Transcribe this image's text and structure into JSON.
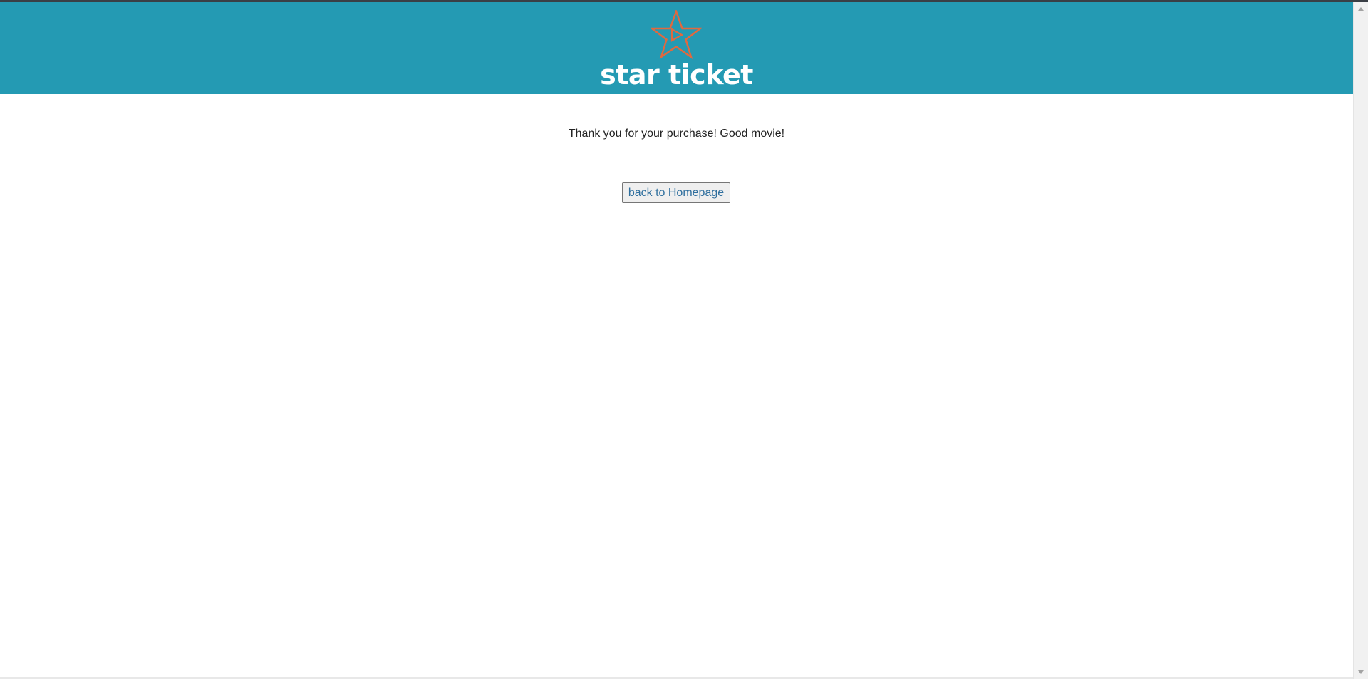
{
  "header": {
    "brand_name": "star ticket",
    "logo_icon": "star-play-icon",
    "background_color": "#249ab3",
    "logo_color": "#e0693f"
  },
  "main": {
    "message": "Thank you for your purchase! Good movie!",
    "home_button_label": "back to Homepage"
  }
}
